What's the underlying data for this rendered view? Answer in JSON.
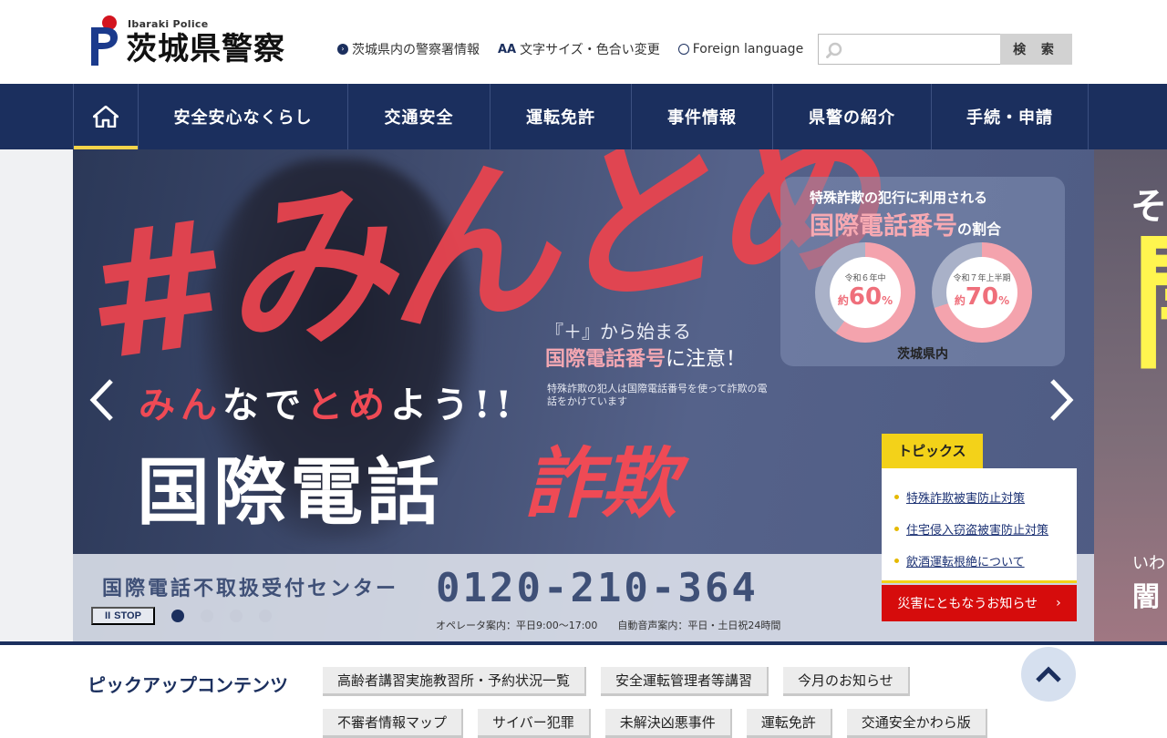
{
  "header": {
    "logo_en": "Ibaraki Police",
    "logo_jp": "茨城県警察",
    "links": [
      {
        "label": "茨城県内の警察署情報",
        "icon": "circle-arrow-icon"
      },
      {
        "label": "文字サイズ・色合い変更",
        "icon_text": "AA"
      },
      {
        "label": "Foreign language",
        "icon": "globe-icon"
      }
    ],
    "search_placeholder": "",
    "search_button": "検 索"
  },
  "nav": {
    "items": [
      "安全安心なくらし",
      "交通安全",
      "運転免許",
      "事件情報",
      "県警の紹介",
      "手続・申請"
    ]
  },
  "hero": {
    "hashtag": "#みんとめ",
    "line_parts": [
      "み",
      "ん",
      "なで",
      "と",
      "め",
      "よう!!"
    ],
    "main_title": "国際電話",
    "main_title_red": "詐欺",
    "plus_line": "『＋』から始まる",
    "plus_line2_hl": "国際電話番号",
    "plus_line2_rest": "に注意！",
    "plus_note": "特殊詐欺の犯人は国際電話番号を使って詐欺の電話をかけています",
    "stat": {
      "title1": "特殊詐欺の犯行に利用される",
      "title2": "国際電話番号",
      "title2_suffix": "の割合",
      "donuts": [
        {
          "label": "令和６年中",
          "prefix": "約",
          "value": 60,
          "unit": "%"
        },
        {
          "label": "令和７年上半期",
          "prefix": "約",
          "value": 70,
          "unit": "%"
        }
      ],
      "footer": "茨城県内"
    },
    "center_name": "国際電話不取扱受付センター",
    "phone": "0120-210-364",
    "hours": "オペレータ案内：平日9:00〜17:00　　自動音声案内：平日・土日祝24時間",
    "stop_label": "STOP",
    "slide_count": 4,
    "active_slide": 0,
    "next_slide": {
      "t1": "そ",
      "t2": "闇",
      "t3": "いわ",
      "t4": "闇"
    }
  },
  "topics": {
    "tab": "トピックス",
    "items": [
      "特殊詐欺被害防止対策",
      "住宅侵入窃盗被害防止対策",
      "飲酒運転根絶について"
    ],
    "disaster_label": "災害にともなうお知らせ"
  },
  "pickup": {
    "title": "ピックアップコンテンツ",
    "buttons": [
      "高齢者講習実施教習所・予約状況一覧",
      "安全運転管理者等講習",
      "今月のお知らせ",
      "不審者情報マップ",
      "サイバー犯罪",
      "未解決凶悪事件",
      "運転免許",
      "交通安全かわら版"
    ]
  },
  "colors": {
    "navy": "#1b2f5e",
    "red": "#e8444f",
    "yellow": "#f3d219",
    "disaster_red": "#d60c0c"
  }
}
